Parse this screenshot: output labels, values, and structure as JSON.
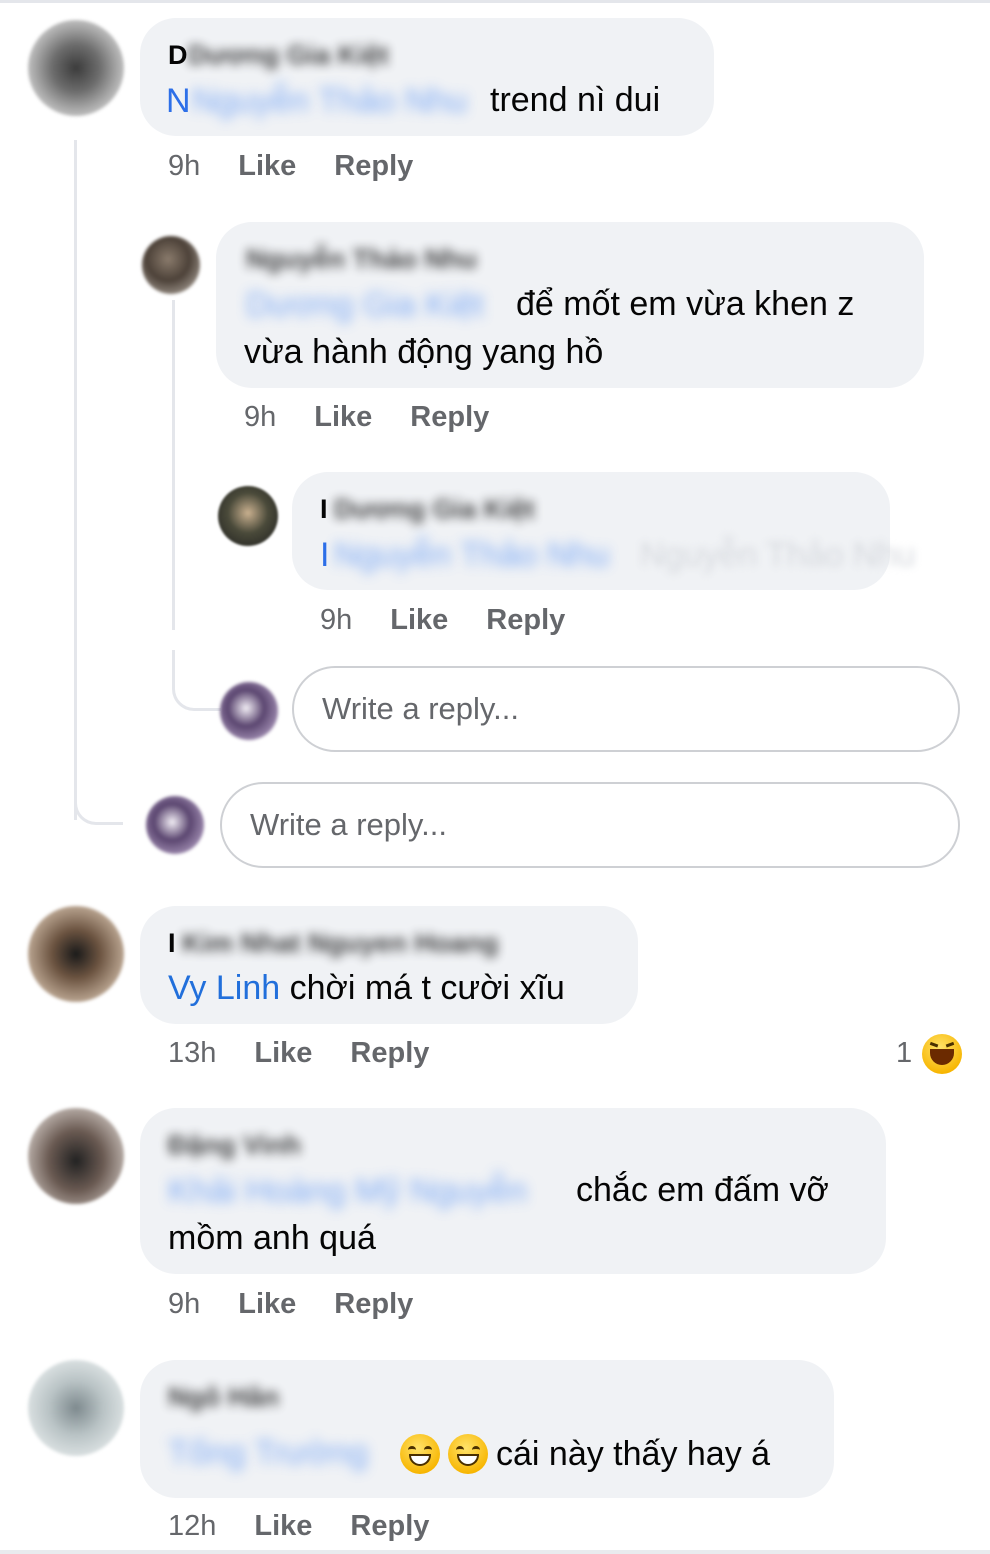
{
  "actions": {
    "like": "Like",
    "reply": "Reply"
  },
  "reply_placeholder": "Write a reply...",
  "comments": [
    {
      "name": "Dương Gia Kiệt",
      "name_first": "D",
      "tag": "Nguyễn Thảo Nhu",
      "tag_first": "N",
      "text": "trend nì dui",
      "time": "9h"
    },
    {
      "name": "Nguyễn Thảo Nhu",
      "tag": "Dương Gia Kiệt",
      "text_line1": "để mốt em vừa khen z",
      "text_line2": "vừa hành động yang hồ",
      "time": "9h"
    },
    {
      "name": "Dương Gia Kiệt",
      "name_first": "I",
      "tag": "Nguyễn Thảo Nhu",
      "tag_first": "I",
      "time": "9h"
    },
    {
      "name": "Kim Nhat Nguyen Hoang",
      "name_first": "I",
      "tag": "Vy Linh",
      "text": "chời má t cười xĩu",
      "time": "13h",
      "reaction_count": "1",
      "reaction_icon": "laughing-emoji-icon"
    },
    {
      "name": "Đặng Vinh",
      "tag": "Khải Hoàng Mỹ Nguyễn",
      "text_line1": "chắc em đấm vỡ",
      "text_line2": "mồm anh quá",
      "time": "9h"
    },
    {
      "name": "Ngô Hân",
      "tag": "Tống Trường",
      "text": "cái này thấy hay á",
      "emoji_icon": "grinning-emoji-icon",
      "time": "12h"
    }
  ]
}
